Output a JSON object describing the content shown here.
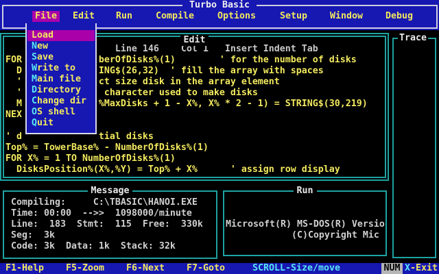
{
  "app": {
    "title": "Turbo Basic"
  },
  "menu_bar": {
    "items": [
      "File",
      "Edit",
      "Run",
      "Compile",
      "Options",
      "Setup",
      "Window",
      "Debug"
    ],
    "active_item": "File"
  },
  "file_menu": {
    "items": [
      {
        "label": "Load",
        "hotkey": "L",
        "rest": "oad",
        "selected": true
      },
      {
        "label": "New",
        "hotkey": "N",
        "rest": "ew",
        "selected": false
      },
      {
        "label": "Save",
        "hotkey": "S",
        "rest": "ave",
        "selected": false
      },
      {
        "label": "Write to",
        "hotkey": "W",
        "rest": "rite to",
        "selected": false
      },
      {
        "label": "Main file",
        "hotkey": "M",
        "rest": "ain file",
        "selected": false
      },
      {
        "label": "Directory",
        "hotkey": "D",
        "rest": "irectory",
        "selected": false
      },
      {
        "label": "Change dir",
        "hotkey": "C",
        "rest": "hange dir",
        "selected": false
      },
      {
        "label": "OS shell",
        "hotkey": "O",
        "rest": "S shell",
        "selected": false
      },
      {
        "label": "Quit",
        "hotkey": "Q",
        "rest": "uit",
        "selected": false
      }
    ]
  },
  "edit_window": {
    "title": "Edit",
    "line_number": "146",
    "column_number": "1",
    "mode_flags": "Insert Indent Tab",
    "status_line": "                     Line 146    Col 1   Insert Indent Tab",
    "code": " FOR              berOfDisks%(1)        ' for the number of disks\n   D              ING$(26,32)  ' fill the array with spaces\n   '              ct size disk in the array element\n   '               character used to make disks\n   M              %MaxDisks + 1 - X%, X% * 2 - 1) = STRING$(30,219)\n NEX\n\n ' d              tial disks\n Top% = TowerBase% - NumberOfDisks%(1)\n FOR X% = 1 TO NumberOfDisks%(1)\n   DisksPosition%(X%,%Y) = Top% + X%      ' assign row display"
  },
  "trace_window": {
    "title": "Trace"
  },
  "message_window": {
    "title": "Message",
    "text": " Compiling:     C:\\TBASIC\\HANOI.EXE\n Time: 00:00  -->>  1098000/minute\n Line:  183  Stmt:  115  Free:  330k\n Seg:  3k\n Code: 3k  Data: 1k  Stack: 32k"
  },
  "run_window": {
    "title": "Run",
    "text": "Microsoft(R) MS-DOS(R) Versio\n            (C)Copyright Mic"
  },
  "status_bar": {
    "keys": [
      "F1-Help",
      "F5-Zoom",
      "F6-Next",
      "F7-Goto"
    ],
    "scroll_hint": "SCROLL-Size/move",
    "num_indicator": "NUM",
    "exit_hotkey": "X",
    "exit_rest": "-Exit"
  },
  "colors": {
    "background_blue": "#1717b2",
    "highlight_magenta": "#aa00aa",
    "text_yellow": "#f2e95e",
    "hotkey_cyan": "#59e6f5",
    "border_teal": "#1fa3a3",
    "dropdown_border": "#d8d8ea",
    "title_white": "#eaeaea",
    "status_gray": "#cfcfcf"
  }
}
